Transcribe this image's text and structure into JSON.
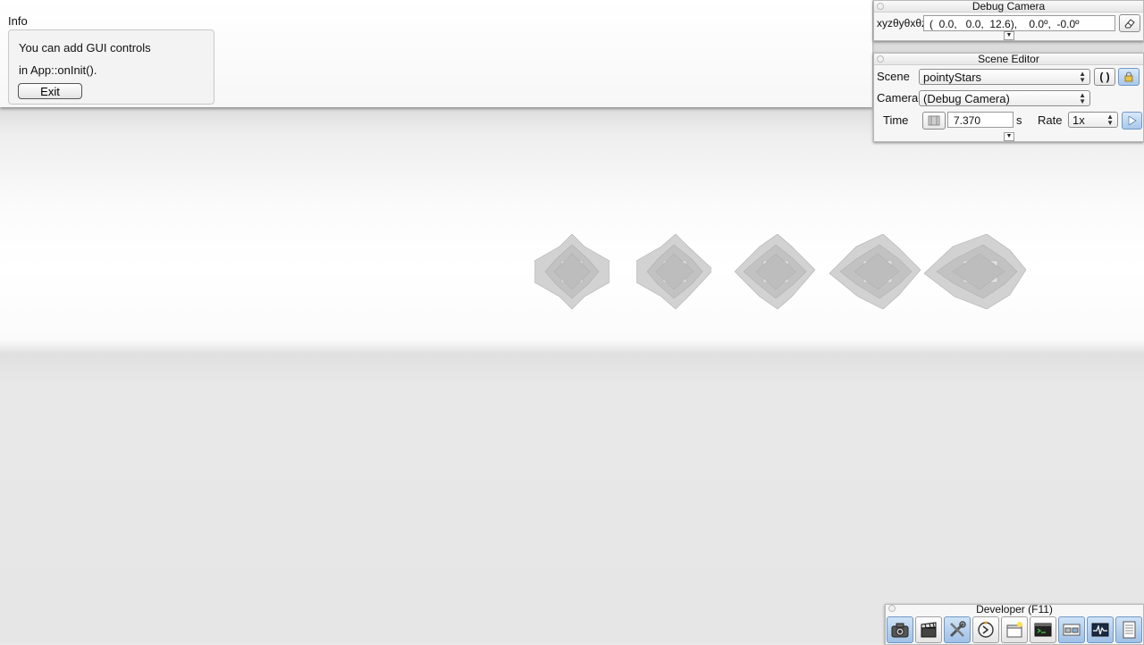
{
  "info": {
    "title": "Info",
    "line1": "You can add GUI controls",
    "line2": "in App::onInit().",
    "exit_label": "Exit"
  },
  "debug_camera": {
    "title": "Debug Camera",
    "xyz_label": "xyzθyθxθz",
    "position_value": "(  0.0,   0.0,  12.6),    0.0º,  -0.0º"
  },
  "scene_editor": {
    "title": "Scene Editor",
    "scene_label": "Scene",
    "scene_value": "pointyStars",
    "camera_label": "Camera",
    "camera_value": "(Debug Camera)",
    "time_label": "Time",
    "time_value": "7.370",
    "time_unit": "s",
    "rate_label": "Rate",
    "rate_value": "1x"
  },
  "developer": {
    "title": "Developer (F11)",
    "tools": [
      {
        "icon": "camera-icon",
        "active": true
      },
      {
        "icon": "clapperboard-icon",
        "active": false
      },
      {
        "icon": "tools-icon",
        "active": true
      },
      {
        "icon": "speedometer-icon",
        "active": false
      },
      {
        "icon": "new-window-icon",
        "active": false
      },
      {
        "icon": "terminal-icon",
        "active": false
      },
      {
        "icon": "scene-graph-icon",
        "active": true
      },
      {
        "icon": "profiler-icon",
        "active": true
      },
      {
        "icon": "log-icon",
        "active": true
      }
    ]
  },
  "colors": {
    "accent_blue": "#a8c8ea",
    "panel_bg": "#f6f6f6"
  }
}
